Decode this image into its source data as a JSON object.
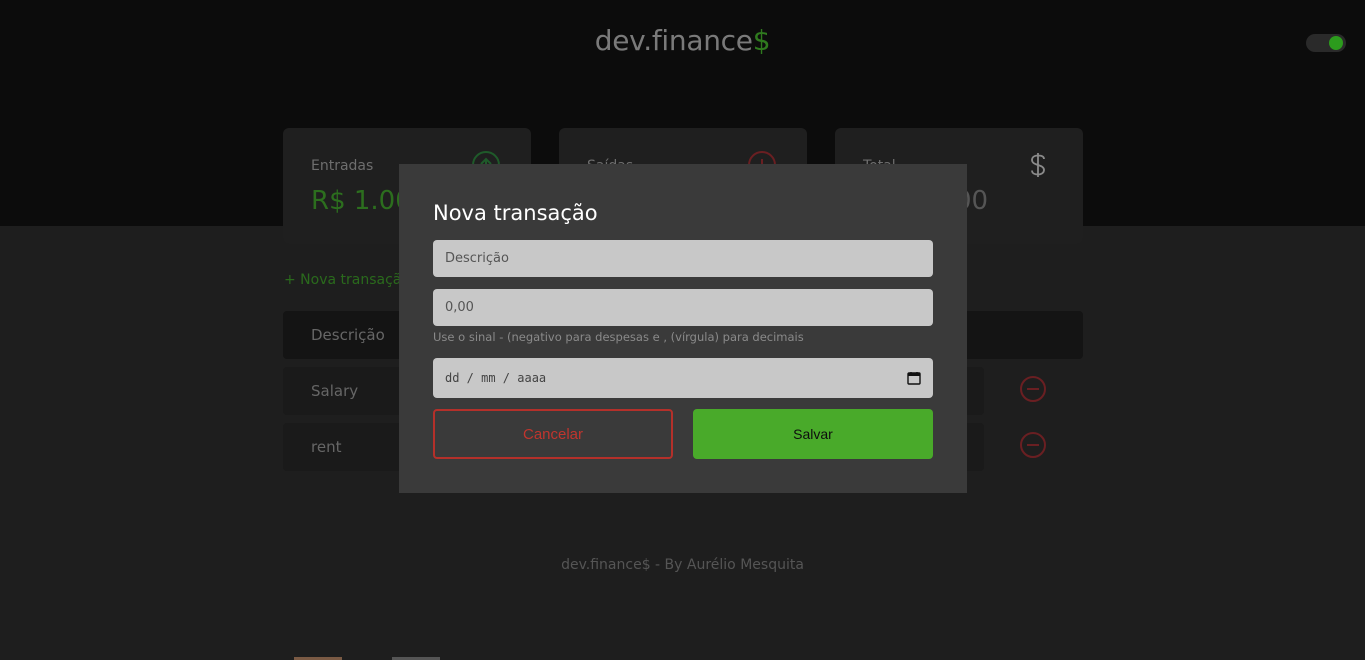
{
  "header": {
    "logo_main": "dev.finance",
    "logo_accent": "$",
    "theme_toggle": "dark-mode-toggle"
  },
  "cards": [
    {
      "label": "Entradas",
      "value": "R$ 1.00",
      "icon": "income-arrow-up-icon"
    },
    {
      "label": "Saídas",
      "value": "",
      "icon": "expense-arrow-down-icon"
    },
    {
      "label": "Total",
      "value": "00",
      "icon": "dollar-sign-icon"
    }
  ],
  "new_transaction_link": "+ Nova transaçã",
  "table": {
    "header": "Descrição",
    "rows": [
      {
        "description": "Salary"
      },
      {
        "description": "rent"
      }
    ]
  },
  "footer": "dev.finance$ - By Aurélio Mesquita",
  "modal": {
    "title": "Nova transação",
    "description_placeholder": "Descrição",
    "amount_placeholder": "0,00",
    "help_text": "Use o sinal - (negativo para despesas e , (vírgula) para decimais",
    "date_placeholder": "dd / mm / aaaa",
    "cancel_label": "Cancelar",
    "save_label": "Salvar"
  },
  "colors": {
    "accent_green": "#49aa2a",
    "danger_red": "#c0352e",
    "modal_bg": "#3a3a3a"
  }
}
